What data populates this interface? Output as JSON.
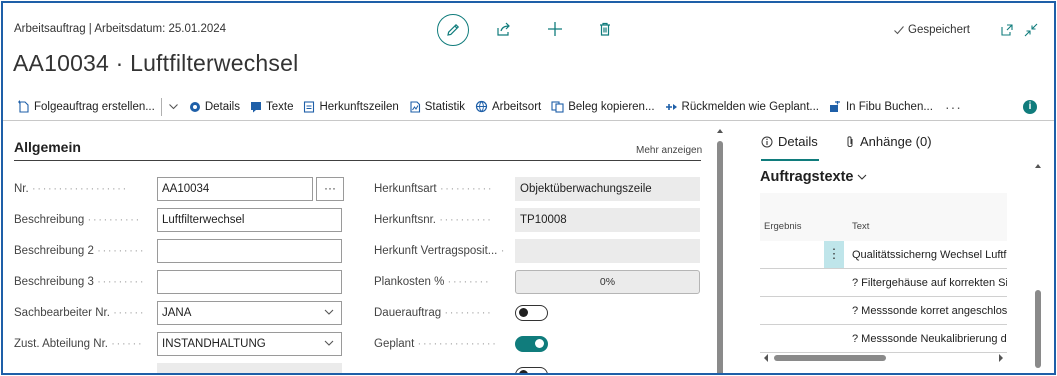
{
  "header": {
    "subtitle": "Arbeitsauftrag | Arbeitsdatum: 25.01.2024",
    "title": "AA10034 · Luftfilterwechsel",
    "saved_label": "Gespeichert"
  },
  "toolbar": {
    "followup": "Folgeauftrag erstellen...",
    "details": "Details",
    "texte": "Texte",
    "herkunftszeilen": "Herkunftszeilen",
    "statistik": "Statistik",
    "arbeitsort": "Arbeitsort",
    "beleg_kopieren": "Beleg kopieren...",
    "rueckmelden": "Rückmelden wie Geplant...",
    "fibu": "In Fibu Buchen...",
    "more": "···"
  },
  "general": {
    "title": "Allgemein",
    "show_more": "Mehr anzeigen",
    "nr_label": "Nr.",
    "nr_value": "AA10034",
    "lookup": "···",
    "beschreibung_label": "Beschreibung",
    "beschreibung_value": "Luftfilterwechsel",
    "beschreibung2_label": "Beschreibung 2",
    "beschreibung2_value": "",
    "beschreibung3_label": "Beschreibung 3",
    "beschreibung3_value": "",
    "sachbearbeiter_label": "Sachbearbeiter Nr.",
    "sachbearbeiter_value": "JANA",
    "abteilung_label": "Zust. Abteilung Nr.",
    "abteilung_value": "INSTANDHALTUNG",
    "herkunftsart_label": "Herkunftsart",
    "herkunftsart_value": "Objektüberwachungszeile",
    "herkunftsnr_label": "Herkunftsnr.",
    "herkunftsnr_value": "TP10008",
    "vertragsposition_label": "Herkunft Vertragsposit...",
    "vertragsposition_value": "",
    "plankosten_label": "Plankosten %",
    "plankosten_value": "0%",
    "plankosten_fraction": 0,
    "dauerauftrag_label": "Dauerauftrag",
    "dauerauftrag_on": false,
    "geplant_label": "Geplant",
    "geplant_on": true
  },
  "panel": {
    "tab_details": "Details",
    "tab_attachments": "Anhänge (0)",
    "section_title": "Auftragstexte",
    "col_result": "Ergebnis",
    "col_text": "Text",
    "rows": [
      "Qualitätssicherng Wechsel Luftfilter",
      "? Filtergehäuse auf korrekten Sitz",
      "? Messsonde korret angeschlossen",
      "? Messsonde Neukalibrierung durchführen"
    ],
    "row_menu": "⋮"
  },
  "colors": {
    "accent": "#107c7c",
    "frame": "#1e5fa8"
  }
}
